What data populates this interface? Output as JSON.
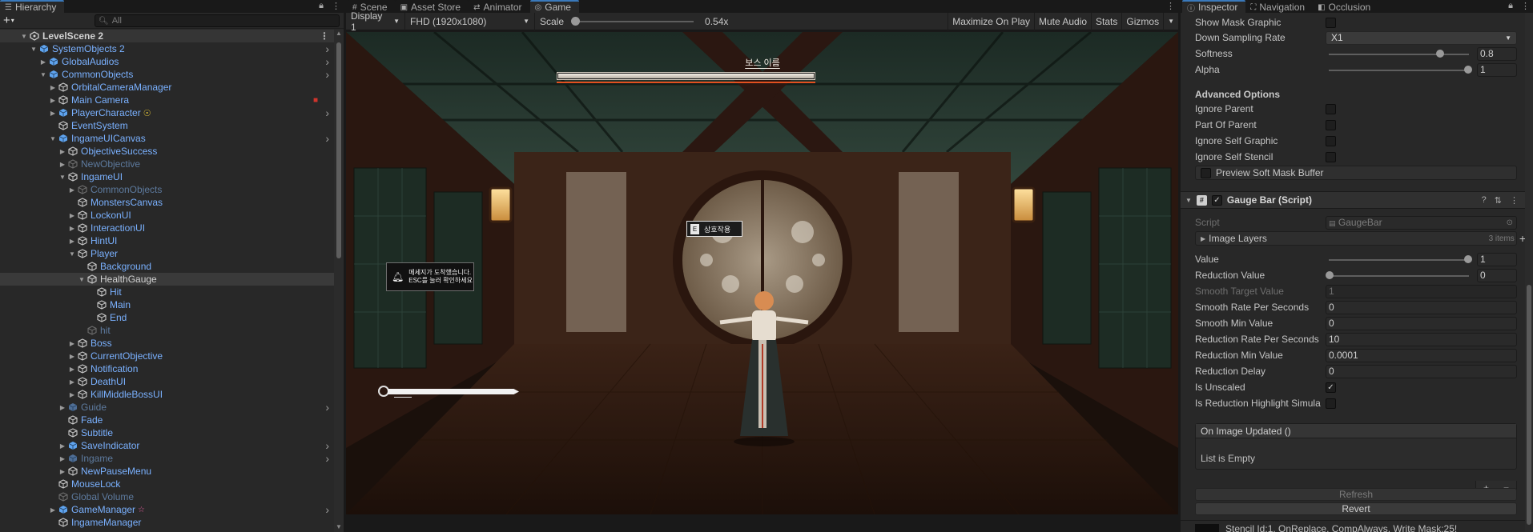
{
  "colors": {
    "accent": "#3a79bb",
    "prefab_blue": "#7ab1ff",
    "panel": "#282828",
    "boss_bar": "#e2501f"
  },
  "hierarchy": {
    "tab": "Hierarchy",
    "search_placeholder": "All",
    "rows": [
      {
        "label": "LevelScene 2",
        "depth": 0,
        "arrow": "down",
        "type": "scene",
        "color": "white",
        "scene": true,
        "menu": true
      },
      {
        "label": "SystemObjects 2",
        "depth": 1,
        "arrow": "down",
        "type": "prefab",
        "color": "blue",
        "chev": true
      },
      {
        "label": "GlobalAudios",
        "depth": 2,
        "arrow": "right",
        "type": "prefab",
        "color": "blue",
        "chev": true
      },
      {
        "label": "CommonObjects",
        "depth": 2,
        "arrow": "down",
        "type": "prefab",
        "color": "blue",
        "chev": true
      },
      {
        "label": "OrbitalCameraManager",
        "depth": 3,
        "arrow": "right",
        "type": "object",
        "color": "blue"
      },
      {
        "label": "Main Camera",
        "depth": 3,
        "arrow": "right",
        "type": "object",
        "color": "blue",
        "badge": "camera"
      },
      {
        "label": "PlayerCharacter",
        "depth": 3,
        "arrow": "right",
        "type": "prefab",
        "color": "blue",
        "extra": "sun",
        "chev": true
      },
      {
        "label": "EventSystem",
        "depth": 3,
        "arrow": "none",
        "type": "object",
        "color": "blue"
      },
      {
        "label": "IngameUICanvas",
        "depth": 3,
        "arrow": "down",
        "type": "prefab",
        "color": "blue",
        "chev": true
      },
      {
        "label": "ObjectiveSuccess",
        "depth": 4,
        "arrow": "right",
        "type": "object",
        "color": "blue"
      },
      {
        "label": "NewObjective",
        "depth": 4,
        "arrow": "right",
        "type": "object",
        "color": "dim"
      },
      {
        "label": "IngameUI",
        "depth": 4,
        "arrow": "down",
        "type": "object",
        "color": "blue"
      },
      {
        "label": "CommonObjects",
        "depth": 5,
        "arrow": "right",
        "type": "object",
        "color": "dim"
      },
      {
        "label": "MonstersCanvas",
        "depth": 5,
        "arrow": "none",
        "type": "object",
        "color": "blue"
      },
      {
        "label": "LockonUI",
        "depth": 5,
        "arrow": "right",
        "type": "object",
        "color": "blue"
      },
      {
        "label": "InteractionUI",
        "depth": 5,
        "arrow": "right",
        "type": "object",
        "color": "blue"
      },
      {
        "label": "HintUI",
        "depth": 5,
        "arrow": "right",
        "type": "object",
        "color": "blue"
      },
      {
        "label": "Player",
        "depth": 5,
        "arrow": "down",
        "type": "object",
        "color": "blue"
      },
      {
        "label": "Background",
        "depth": 6,
        "arrow": "none",
        "type": "object",
        "color": "blue"
      },
      {
        "label": "HealthGauge",
        "depth": 6,
        "arrow": "down",
        "type": "object",
        "color": "white",
        "selected": true
      },
      {
        "label": "Hit",
        "depth": 7,
        "arrow": "none",
        "type": "object",
        "color": "blue"
      },
      {
        "label": "Main",
        "depth": 7,
        "arrow": "none",
        "type": "object",
        "color": "blue"
      },
      {
        "label": "End",
        "depth": 7,
        "arrow": "none",
        "type": "object",
        "color": "blue"
      },
      {
        "label": "hit",
        "depth": 6,
        "arrow": "none",
        "type": "object",
        "color": "dim"
      },
      {
        "label": "Boss",
        "depth": 5,
        "arrow": "right",
        "type": "object",
        "color": "blue"
      },
      {
        "label": "CurrentObjective",
        "depth": 5,
        "arrow": "right",
        "type": "object",
        "color": "blue"
      },
      {
        "label": "Notification",
        "depth": 5,
        "arrow": "right",
        "type": "object",
        "color": "blue"
      },
      {
        "label": "DeathUI",
        "depth": 5,
        "arrow": "right",
        "type": "object",
        "color": "blue"
      },
      {
        "label": "KillMiddleBossUI",
        "depth": 5,
        "arrow": "right",
        "type": "object",
        "color": "blue"
      },
      {
        "label": "Guide",
        "depth": 4,
        "arrow": "right",
        "type": "prefab",
        "color": "dim",
        "chev": true
      },
      {
        "label": "Fade",
        "depth": 4,
        "arrow": "none",
        "type": "object",
        "color": "blue"
      },
      {
        "label": "Subtitle",
        "depth": 4,
        "arrow": "none",
        "type": "object",
        "color": "blue"
      },
      {
        "label": "SaveIndicator",
        "depth": 4,
        "arrow": "right",
        "type": "prefab",
        "color": "blue",
        "chev": true
      },
      {
        "label": "Ingame",
        "depth": 4,
        "arrow": "right",
        "type": "prefab",
        "color": "dim",
        "chev": true
      },
      {
        "label": "NewPauseMenu",
        "depth": 4,
        "arrow": "right",
        "type": "object",
        "color": "blue"
      },
      {
        "label": "MouseLock",
        "depth": 3,
        "arrow": "none",
        "type": "object",
        "color": "blue"
      },
      {
        "label": "Global Volume",
        "depth": 3,
        "arrow": "none",
        "type": "object",
        "color": "dim"
      },
      {
        "label": "GameManager",
        "depth": 3,
        "arrow": "right",
        "type": "prefab",
        "color": "blue",
        "extra": "star",
        "chev": true
      },
      {
        "label": "IngameManager",
        "depth": 3,
        "arrow": "none",
        "type": "object",
        "color": "blue"
      }
    ]
  },
  "game": {
    "tabs": {
      "scene": "Scene",
      "asset_store": "Asset Store",
      "animator": "Animator",
      "game": "Game"
    },
    "toolbar": {
      "display": "Display 1",
      "resolution": "FHD (1920x1080)",
      "scale_label": "Scale",
      "scale_value": "0.54x",
      "maximize": "Maximize On Play",
      "mute": "Mute Audio",
      "stats": "Stats",
      "gizmos": "Gizmos"
    },
    "hud": {
      "boss_name": "보스 이름",
      "interact_key": "E",
      "interact_label": "상호작용",
      "notice_line1": "메세지가 도착했습니다.",
      "notice_line2": "ESC를 눌러 확인하세요"
    }
  },
  "inspector": {
    "tabs": {
      "inspector": "Inspector",
      "navigation": "Navigation",
      "occlusion": "Occlusion"
    },
    "show_mask_graphic": "Show Mask Graphic",
    "down_sampling_rate": {
      "label": "Down Sampling Rate",
      "value": "X1"
    },
    "softness": {
      "label": "Softness",
      "value": "0.8",
      "fraction": 0.8
    },
    "alpha": {
      "label": "Alpha",
      "value": "1",
      "fraction": 1
    },
    "advanced_options": "Advanced Options",
    "ignore_parent": "Ignore Parent",
    "part_of_parent": "Part Of Parent",
    "ignore_self_graphic": "Ignore Self Graphic",
    "ignore_self_stencil": "Ignore Self Stencil",
    "preview_button": "Preview Soft Mask Buffer",
    "component_title": "Gauge Bar (Script)",
    "script": {
      "label": "Script",
      "value": "GaugeBar"
    },
    "image_layers": {
      "label": "Image Layers",
      "count": "3 items"
    },
    "value": {
      "label": "Value",
      "value": "1",
      "fraction": 1
    },
    "reduction_value": {
      "label": "Reduction Value",
      "value": "0",
      "fraction": 0
    },
    "smooth_target_value": {
      "label": "Smooth Target Value",
      "value": "1"
    },
    "smooth_rate": {
      "label": "Smooth Rate Per Seconds",
      "value": "0"
    },
    "smooth_min": {
      "label": "Smooth Min Value",
      "value": "0"
    },
    "reduction_rate": {
      "label": "Reduction Rate Per Seconds",
      "value": "10"
    },
    "reduction_min": {
      "label": "Reduction Min Value",
      "value": "0.0001"
    },
    "reduction_delay": {
      "label": "Reduction Delay",
      "value": "0"
    },
    "is_unscaled": {
      "label": "Is Unscaled",
      "checked": true
    },
    "is_reduction_highlight": {
      "label": "Is Reduction Highlight Simula",
      "checked": false
    },
    "event_title": "On Image Updated ()",
    "list_empty": "List is Empty",
    "refresh": "Refresh",
    "revert": "Revert",
    "stencil_info": "Stencil Id:1, OnReplace, CompAlways, Write Mask:25!"
  }
}
